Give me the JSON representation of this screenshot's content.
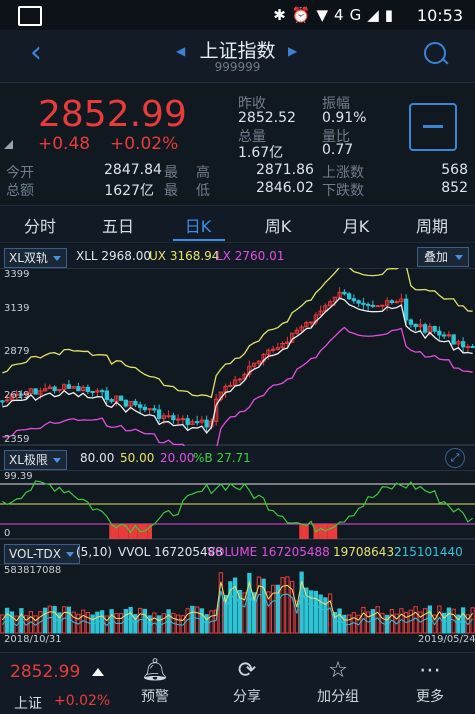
{
  "status": {
    "time": "10:53",
    "network": "4G"
  },
  "header": {
    "title": "上证指数",
    "code": "999999"
  },
  "quote": {
    "price": "2852.99",
    "change": "+0.48",
    "change_pct": "+0.02%",
    "stats": [
      {
        "label": "昨收",
        "value": "2852.52"
      },
      {
        "label": "振幅",
        "value": "0.91%"
      },
      {
        "label": "总量",
        "value": "1.67亿"
      },
      {
        "label": "量比",
        "value": "0.77"
      }
    ],
    "row3": {
      "label_a": "今开",
      "value_a": "2847.84",
      "label_b": "最",
      "label_c": "高",
      "value_c": "2871.86",
      "label_d": "上涨数",
      "value_d": "568"
    },
    "row4": {
      "label_a": "总额",
      "value_a": "1627亿",
      "label_b": "最",
      "label_c": "低",
      "value_c": "2846.02",
      "label_d": "下跌数",
      "value_d": "852"
    }
  },
  "tabs": [
    "分时",
    "五日",
    "日K",
    "周K",
    "月K",
    "周期"
  ],
  "active_tab": "日K",
  "xl_band": {
    "selector": "XL双轨",
    "xll": "XLL 2968.00",
    "ux": "UX 3168.94",
    "lx": "LX 2760.01",
    "add": "叠加",
    "y_ticks": [
      "3399",
      "3139",
      "2879",
      "2619",
      "2359"
    ]
  },
  "xl_limit": {
    "selector": "XL极限",
    "v1": "80.00",
    "v2": "50.00",
    "v3": "20.00",
    "v4": "%B 27.71",
    "y_ticks": [
      "99.39",
      "0"
    ]
  },
  "volume": {
    "selector": "VOL-TDX",
    "params": "(5,10)",
    "vvol": "VVOL 167205488",
    "vol": "VOLUME 167205488",
    "ma5": "197086432",
    "ma10": "215101440",
    "y_top": "583817088",
    "date_start": "2018/10/31",
    "date_end": "2019/05/24"
  },
  "bottom": {
    "price": "2852.99",
    "name": "上证",
    "pct": "+0.02%",
    "items": [
      {
        "label": "预警",
        "icon": "bell-icon"
      },
      {
        "label": "分享",
        "icon": "share-icon"
      },
      {
        "label": "加分组",
        "icon": "star-icon"
      },
      {
        "label": "更多",
        "icon": "more-icon"
      }
    ]
  },
  "colors": {
    "up": "#e83b3b",
    "down": "#2ec4d6",
    "accent": "#3a8ee6"
  }
}
